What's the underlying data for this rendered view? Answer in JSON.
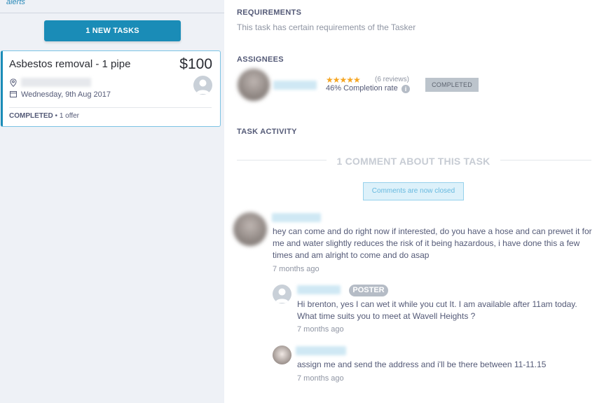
{
  "sidebar": {
    "alerts_link": "alerts",
    "new_tasks_button": "1 NEW TASKS",
    "task": {
      "title": "Asbestos removal - 1 pipe",
      "price": "$100",
      "location": "",
      "date": "Wednesday, 9th Aug 2017",
      "status": "COMPLETED",
      "offers": " • 1 offer"
    }
  },
  "main": {
    "requirements": {
      "heading": "REQUIREMENTS",
      "text": "This task has certain requirements of the Tasker"
    },
    "assignees": {
      "heading": "ASSIGNEES",
      "stars": "★★★★★",
      "rating": 5,
      "reviews": "(6 reviews)",
      "completion_rate": "46% Completion rate",
      "info_icon": "i",
      "status_badge": "COMPLETED"
    },
    "activity": {
      "heading": "TASK ACTIVITY",
      "comment_count": "1 COMMENT ABOUT THIS TASK",
      "closed_notice": "Comments are now closed"
    },
    "comments": [
      {
        "text": "hey can come and do right now if interested, do you have a hose and can prewet it for me and water slightly reduces the risk of it being hazardous, i have done this a few times and am alright to come and do asap",
        "time": "7 months ago"
      }
    ],
    "replies": [
      {
        "badge": "POSTER",
        "text": "Hi brenton, yes I can wet it while you cut It. I am available after 11am today. What time suits you to meet at Wavell Heights ?",
        "time": "7 months ago"
      },
      {
        "text": "assign me and send the address and i'll be there between 11-11.15",
        "time": "7 months ago"
      }
    ]
  },
  "colors": {
    "accent": "#1a8cb7",
    "star": "#f5a623",
    "sidebar_bg": "#eef1f6"
  },
  "icons": [
    "location-pin-icon",
    "calendar-icon",
    "info-icon",
    "default-avatar-icon"
  ]
}
